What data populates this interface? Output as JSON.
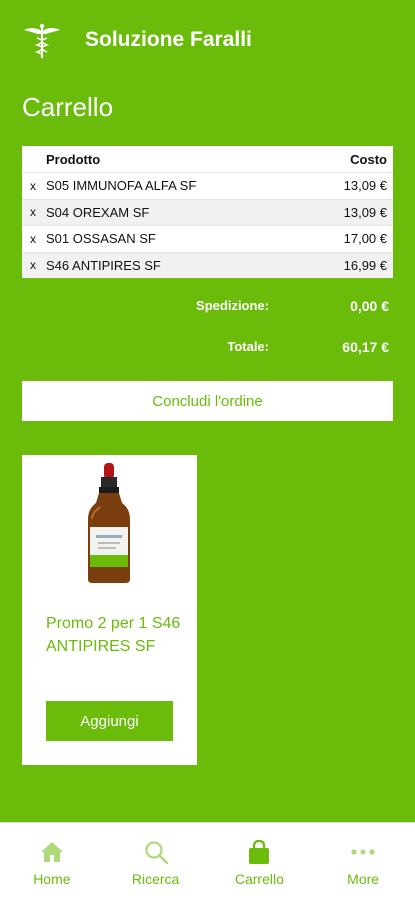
{
  "header": {
    "app_title": "Soluzione Faralli"
  },
  "page": {
    "title": "Carrello"
  },
  "cart": {
    "columns": {
      "product": "Prodotto",
      "cost": "Costo"
    },
    "remove_symbol": "x",
    "items": [
      {
        "name": "S05 IMMUNOFA ALFA SF",
        "cost": "13,09 €"
      },
      {
        "name": "S04 OREXAM SF",
        "cost": "13,09 €"
      },
      {
        "name": "S01 OSSASAN SF",
        "cost": "17,00 €"
      },
      {
        "name": "S46 ANTIPIRES SF",
        "cost": "16,99 €"
      }
    ],
    "shipping_label": "Spedizione:",
    "shipping_value": "0,00 €",
    "total_label": "Totale:",
    "total_value": "60,17 €",
    "checkout_label": "Concludi l'ordine"
  },
  "promo": {
    "product_name": "Promo 2 per 1 S46 ANTIPIRES SF",
    "add_label": "Aggiungi",
    "image_icon": "dropper-bottle-icon"
  },
  "tabbar": {
    "items": [
      {
        "label": "Home",
        "icon": "home-icon"
      },
      {
        "label": "Ricerca",
        "icon": "search-icon"
      },
      {
        "label": "Carrello",
        "icon": "shopping-bag-icon"
      },
      {
        "label": "More",
        "icon": "more-icon"
      }
    ]
  },
  "colors": {
    "brand": "#6bbb0b",
    "surface": "#ffffff"
  }
}
